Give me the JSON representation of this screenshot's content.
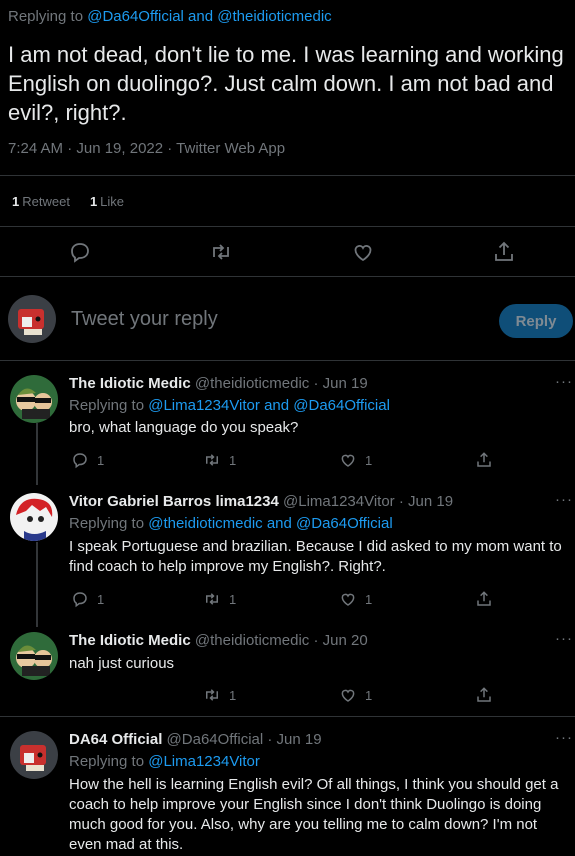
{
  "top": {
    "replying_prefix": "Replying to ",
    "replying_handles": "@Da64Official and @theidioticmedic",
    "text": "I am not dead, don't lie to me. I was learning and working English on duolingo?. Just calm down. I am not bad and evil?, right?.",
    "meta": "7:24 AM · Jun 19, 2022 · Twitter Web App",
    "retweets_count": "1",
    "retweets_label": "Retweet",
    "likes_count": "1",
    "likes_label": "Like"
  },
  "compose": {
    "placeholder": "Tweet your reply",
    "reply_label": "Reply"
  },
  "replies": [
    {
      "name": "The Idiotic Medic",
      "handle_date": "@theidioticmedic · Jun 19",
      "replying_prefix": "Replying to ",
      "replying_handles": "@Lima1234Vitor and @Da64Official",
      "text": "bro, what language do you speak?",
      "reply_count": "1",
      "retweet_count": "1",
      "like_count": "1"
    },
    {
      "name": "Vitor Gabriel Barros lima1234",
      "handle_date": "@Lima1234Vitor · Jun 19",
      "replying_prefix": "Replying to ",
      "replying_handles": "@theidioticmedic and @Da64Official",
      "text": "I speak Portuguese and brazilian. Because I did asked to my mom want to find coach to help improve my English?. Right?.",
      "reply_count": "1",
      "retweet_count": "1",
      "like_count": "1"
    },
    {
      "name": "The Idiotic Medic",
      "handle_date": "@theidioticmedic · Jun 20",
      "text": "nah just curious",
      "retweet_count": "1",
      "like_count": "1"
    },
    {
      "name": "DA64 Official",
      "handle_date": "@Da64Official · Jun 19",
      "replying_prefix": "Replying to ",
      "replying_handles": "@Lima1234Vitor",
      "text": "How the hell is learning English evil? Of all things, I think you should get a coach to help improve your English since I don't think Duolingo is doing much good for you. Also, why are you telling me to calm down? I'm not even mad at this."
    }
  ],
  "more_glyph": "···",
  "colors": {
    "link": "#1d9bf0",
    "muted": "#71767b",
    "text": "#e7e9ea",
    "divider": "#2f3336",
    "reply_button": "#0f4e78"
  }
}
